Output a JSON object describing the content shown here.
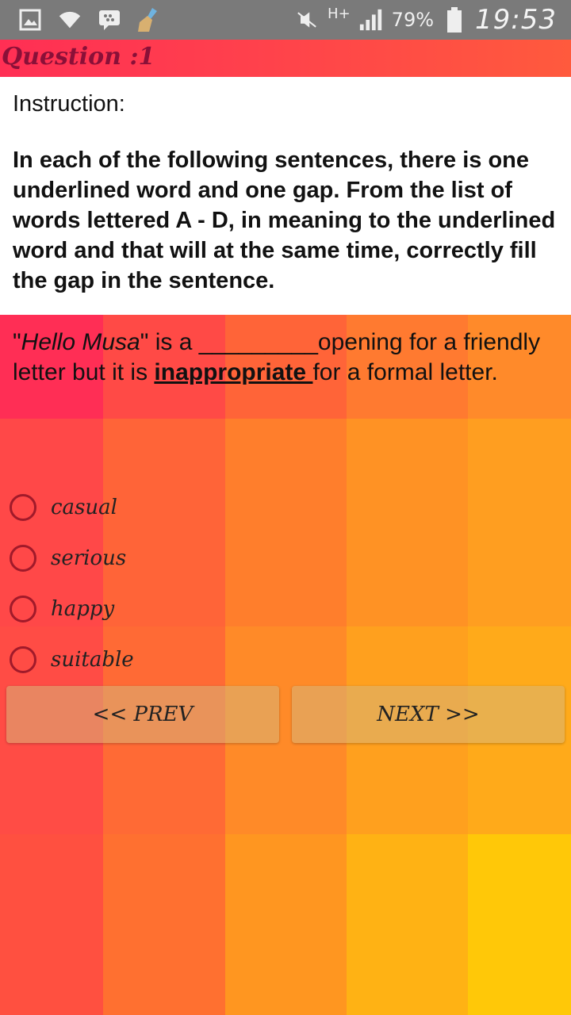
{
  "status_bar": {
    "network": "H+",
    "battery": "79%",
    "clock": "19:53",
    "icons": [
      "image-icon",
      "wifi-icon",
      "bbm-icon",
      "cleaner-icon",
      "mute-icon",
      "signal-icon",
      "battery-icon"
    ]
  },
  "header": {
    "title": "Question :1"
  },
  "instruction": {
    "label": "Instruction:",
    "text": "In each of the following sentences, there is one underlined word and one gap. From the list of words lettered A - D, in meaning to the underlined word and that will at the same time, correctly fill the gap in the sentence."
  },
  "question": {
    "quote_open": "\"",
    "name": "Hello Musa",
    "part1": "\" is a ",
    "blank": "_________",
    "part2": "opening for a friendly letter but it is ",
    "underlined": "inappropriate ",
    "part3": "for a formal letter."
  },
  "options": [
    {
      "label": "casual"
    },
    {
      "label": "serious"
    },
    {
      "label": "happy"
    },
    {
      "label": "suitable"
    }
  ],
  "buttons": {
    "prev": "<< PREV",
    "next": "NEXT >>"
  },
  "colors": {
    "status_bar": "#7a7a7a",
    "header": "#ff3f4d",
    "radio": "#a11a2a",
    "bg_tiles": [
      "#ff3b52",
      "#ff5540",
      "#ff6d34",
      "#ff8a2a",
      "#ffa21f",
      "#ffc40a"
    ]
  }
}
